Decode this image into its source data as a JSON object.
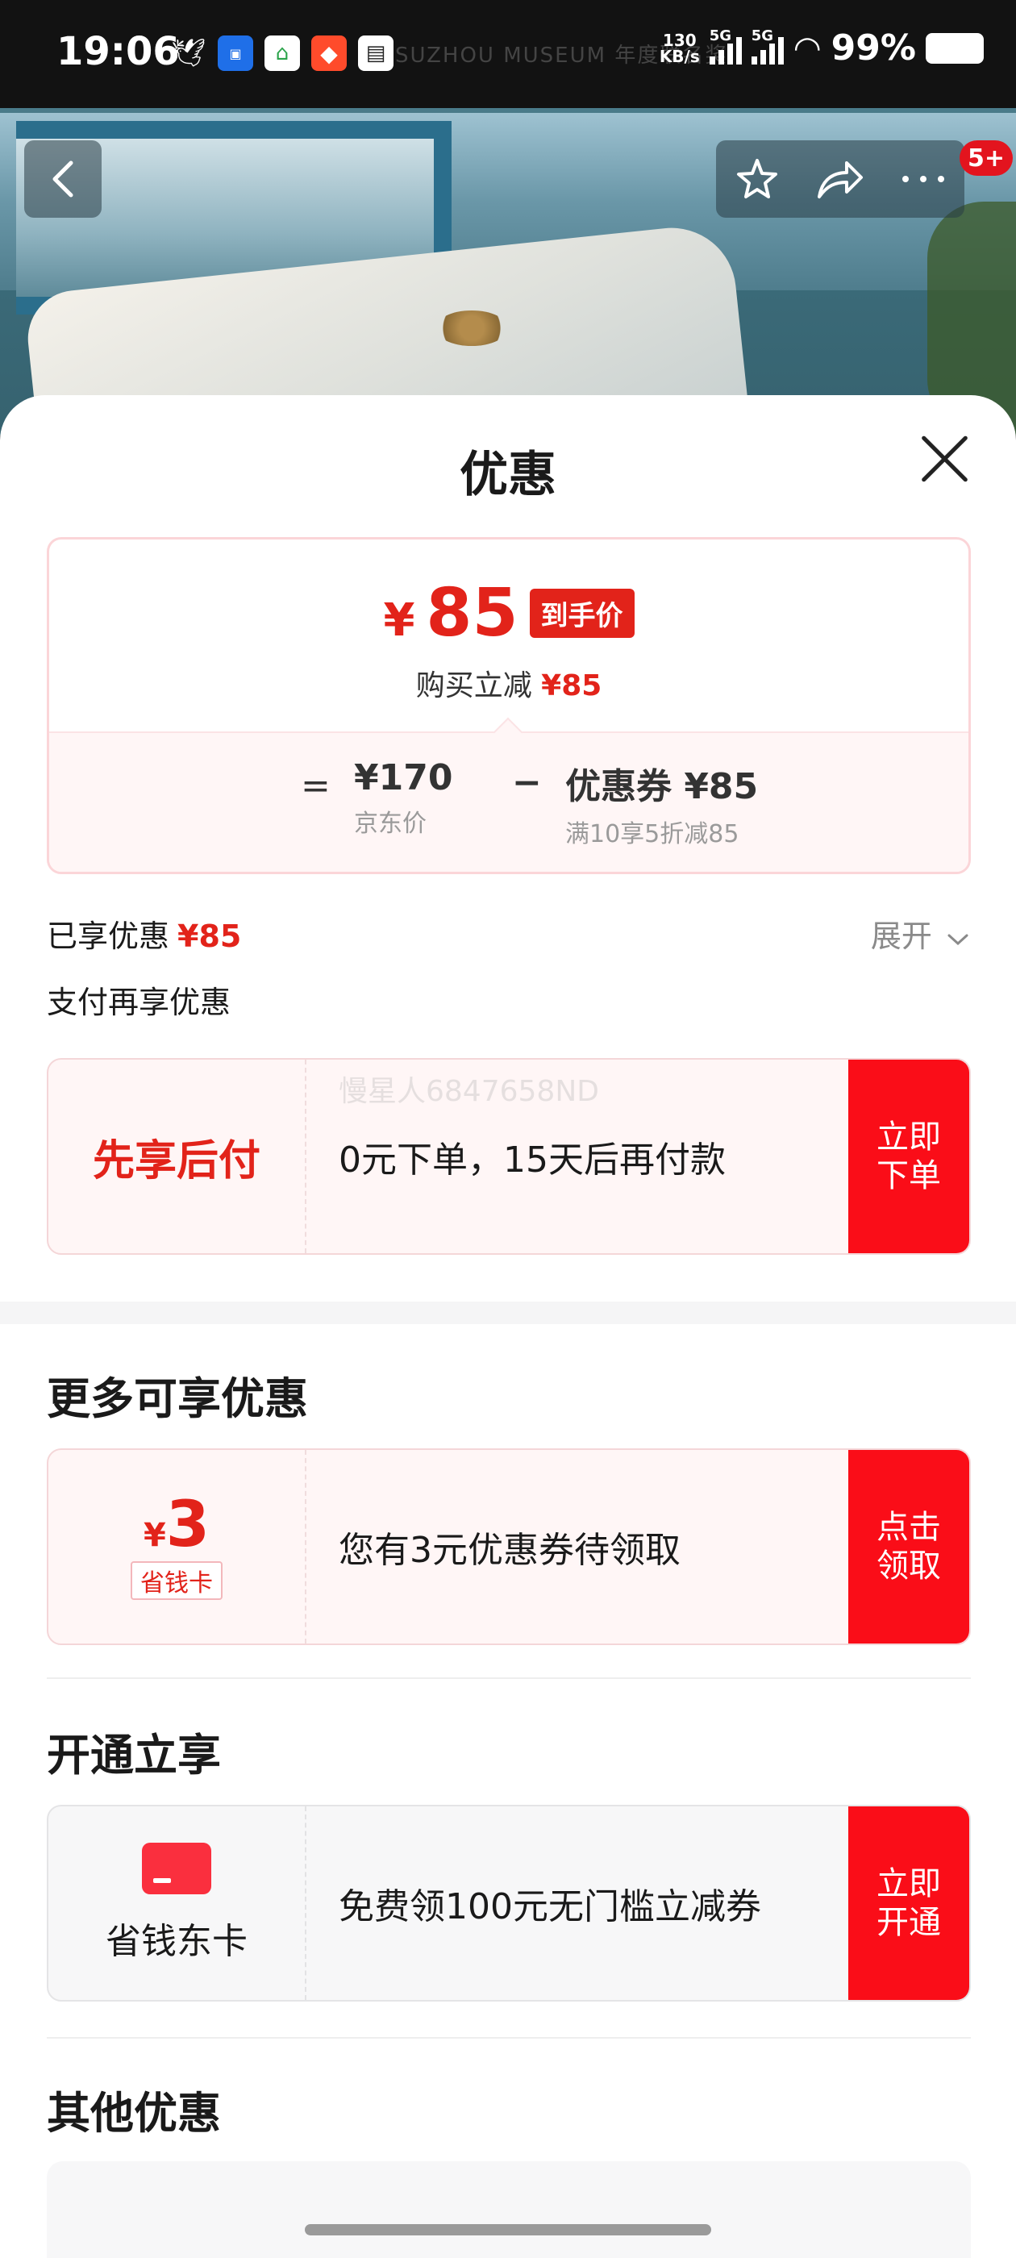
{
  "status_bar": {
    "time": "19:06",
    "net_speed_value": "130",
    "net_speed_unit": "KB/s",
    "signal_1": "5G",
    "signal_2": "5G",
    "battery": "99%",
    "faint_banner": "SUZHOU MUSEUM 年度联名奖"
  },
  "hero": {
    "badge": "5+"
  },
  "sheet": {
    "title": "优惠",
    "price": {
      "currency": "¥",
      "final_price": "85",
      "tag": "到手价",
      "sub_label": "购买立减",
      "sub_value": "¥85",
      "jd_price_value": "¥170",
      "jd_price_label": "京东价",
      "coupon_value": "优惠券 ¥85",
      "coupon_label": "满10享5折减85"
    },
    "enjoyed_label": "已享优惠",
    "enjoyed_value": "¥85",
    "expand_label": "展开",
    "pay_title": "支付再享优惠",
    "pay_card": {
      "left": "先享后付",
      "text": "0元下单，15天后再付款",
      "button": "立即下单",
      "watermark": "慢星人6847658ND"
    },
    "more_title": "更多可享优惠",
    "saver_card": {
      "currency": "¥",
      "amount": "3",
      "tag": "省钱卡",
      "text": "您有3元优惠券待领取",
      "button": "点击领取"
    },
    "open_title": "开通立享",
    "member_card": {
      "label": "省钱东卡",
      "text": "免费领100元无门槛立减券",
      "button": "立即开通"
    },
    "other_title": "其他优惠"
  },
  "icons": {
    "back": "chevron-left-icon",
    "favorite": "star-icon",
    "share": "share-icon",
    "more": "more-icon",
    "close": "close-icon",
    "expand": "chevron-down-icon",
    "member": "card-icon"
  },
  "colors": {
    "accent_red": "#e2231a",
    "button_red": "#fa0d18"
  }
}
